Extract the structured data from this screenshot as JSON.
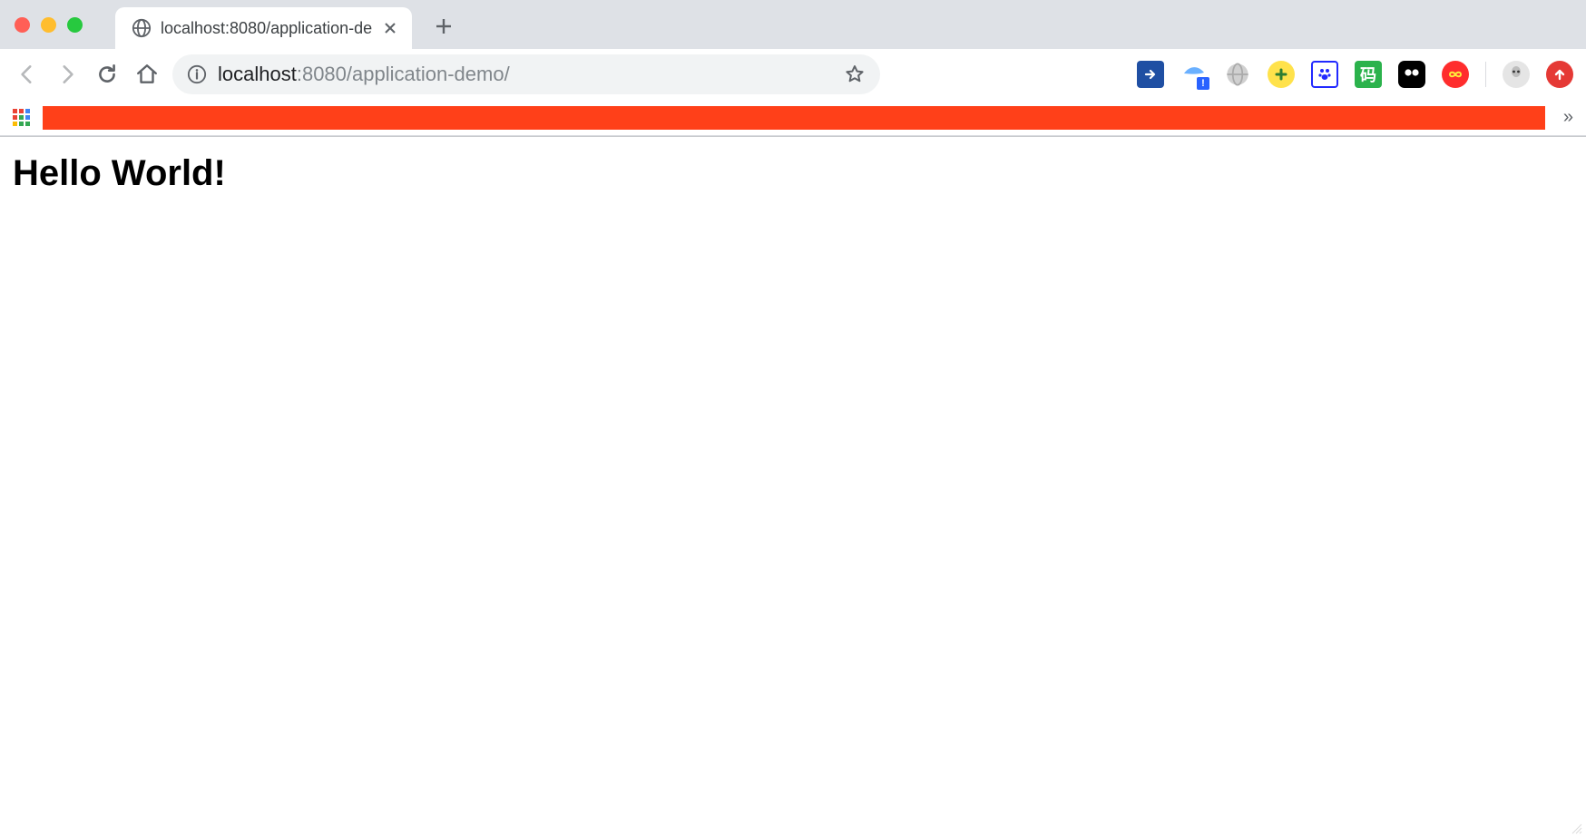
{
  "window": {
    "controls": {
      "close": "close",
      "minimize": "minimize",
      "maximize": "maximize"
    }
  },
  "tab": {
    "title": "localhost:8080/application-de"
  },
  "address": {
    "scheme_hidden": true,
    "host": "localhost",
    "port": ":8080",
    "path": "/application-demo/"
  },
  "extensions": [
    {
      "name": "arrow-ext",
      "bg": "#1f4fa3",
      "glyph": "➔"
    },
    {
      "name": "bird-ext",
      "bg": "#ffffff",
      "glyph": ""
    },
    {
      "name": "globe-ext",
      "bg": "#cfcfcf",
      "glyph": ""
    },
    {
      "name": "plus-ext",
      "bg": "#ffe24b",
      "glyph": "✚"
    },
    {
      "name": "paw-ext",
      "bg": "#2129ff",
      "glyph": ""
    },
    {
      "name": "code-ext",
      "bg": "#2bb24c",
      "glyph": "码"
    },
    {
      "name": "dots-ext",
      "bg": "#000000",
      "glyph": ""
    },
    {
      "name": "infinity-ext",
      "bg": "#ff2d2d",
      "glyph": "∞"
    },
    {
      "name": "profile-ext",
      "bg": "#e5e5e5",
      "glyph": ""
    },
    {
      "name": "upload-ext",
      "bg": "#e53935",
      "glyph": "↑"
    }
  ],
  "bookmarks": {
    "overflow_glyph": "»",
    "bar_color": "#ff4019"
  },
  "page": {
    "heading": "Hello World!"
  }
}
